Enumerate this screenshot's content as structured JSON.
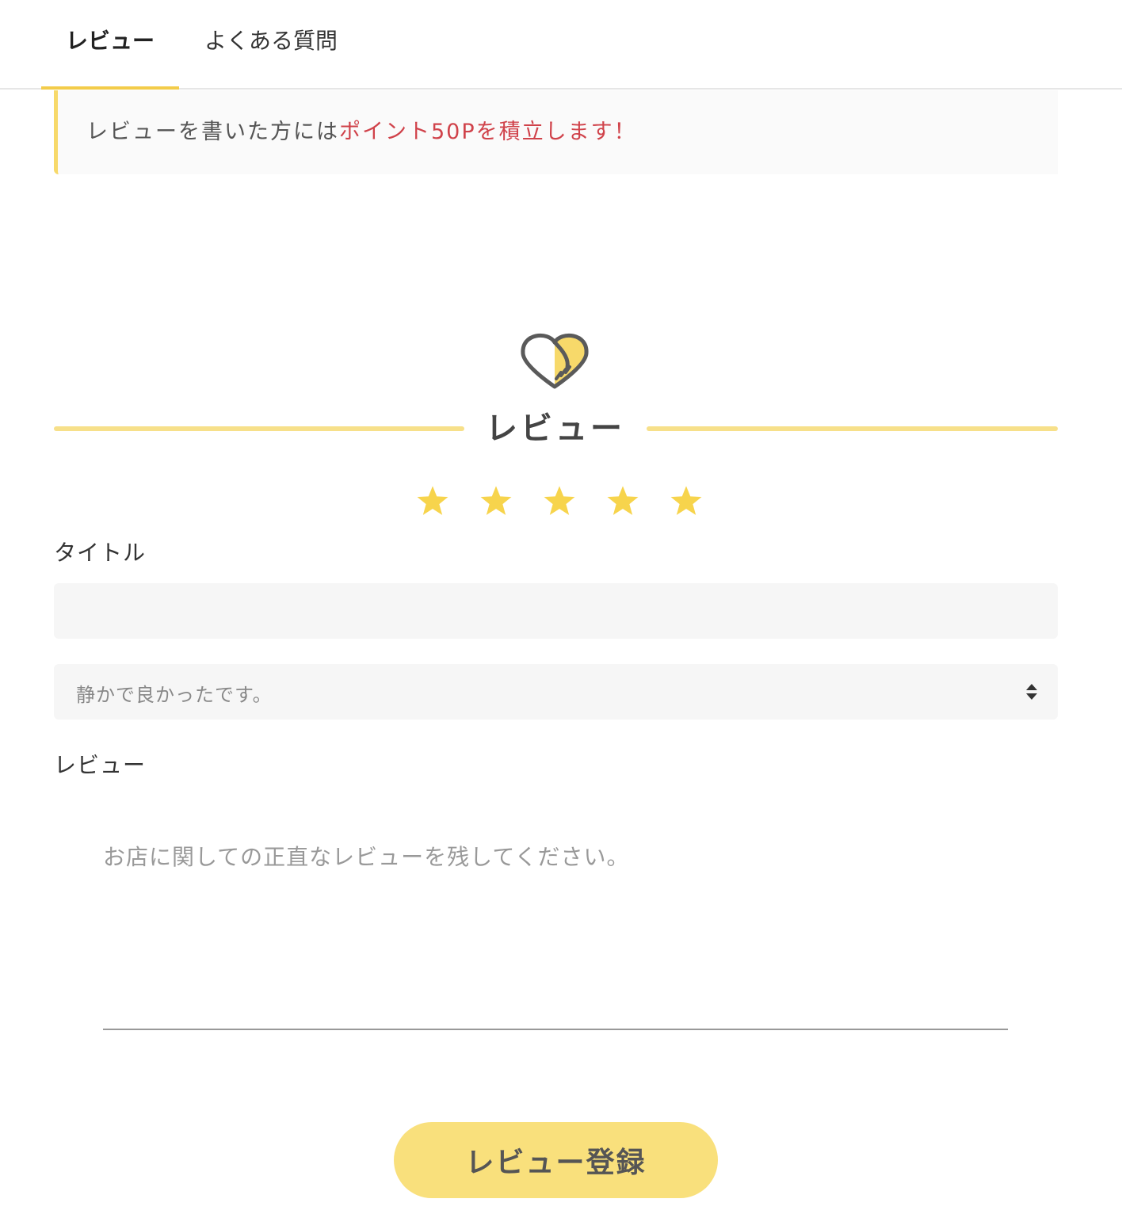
{
  "tabs": [
    {
      "label": "レビュー",
      "active": true
    },
    {
      "label": "よくある質問",
      "active": false
    }
  ],
  "notice": {
    "text_plain": "レビューを書いた方には",
    "text_highlight": "ポイント50Pを積立します！"
  },
  "section": {
    "icon": "heart-hands-icon",
    "title": "レビュー"
  },
  "rating": {
    "value": 5,
    "max": 5
  },
  "form": {
    "title_label": "タイトル",
    "title_value": "",
    "select_value": "静かで良かったです。",
    "review_label": "レビュー",
    "review_placeholder": "お店に関しての正直なレビューを残してください。",
    "submit_label": "レビュー登録"
  },
  "colors": {
    "accent_yellow": "#f7d96a",
    "star_yellow": "#f7d44c",
    "highlight_red": "#d0424a",
    "button_yellow": "#f9e07c"
  }
}
